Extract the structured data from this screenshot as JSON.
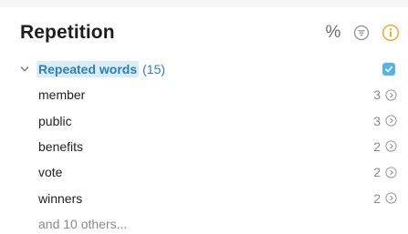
{
  "header": {
    "title": "Repetition",
    "percent_label": "%",
    "filter_icon": "filter-circle-icon",
    "info_icon": "info-circle-icon",
    "info_color": "#f0a020"
  },
  "group": {
    "label": "Repeated words",
    "count": "(15)",
    "checked": true,
    "accent": "#56b4e6"
  },
  "words": [
    {
      "word": "member",
      "count": "3"
    },
    {
      "word": "public",
      "count": "3"
    },
    {
      "word": "benefits",
      "count": "2"
    },
    {
      "word": "vote",
      "count": "2"
    },
    {
      "word": "winners",
      "count": "2"
    }
  ],
  "more_label": "and 10 others..."
}
